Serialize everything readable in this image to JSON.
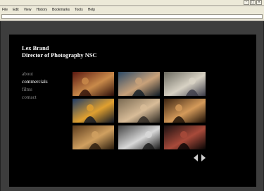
{
  "browser": {
    "menu": [
      "File",
      "Edit",
      "View",
      "History",
      "Bookmarks",
      "Tools",
      "Help"
    ],
    "window_buttons": [
      "minimize",
      "maximize",
      "close"
    ]
  },
  "site": {
    "brand_name": "Lex Brand",
    "brand_title": "Director of Photography NSC",
    "nav": [
      {
        "label": "about",
        "active": false
      },
      {
        "label": "commercials",
        "active": true
      },
      {
        "label": "films",
        "active": false
      },
      {
        "label": "contact",
        "active": false
      }
    ],
    "thumbnails": [
      {
        "name": "thumb-couple-in-car",
        "palette": [
          "#5a1810",
          "#c98a4a",
          "#2a0c08"
        ]
      },
      {
        "name": "thumb-woman-at-window",
        "palette": [
          "#2c4a66",
          "#c9a27a",
          "#0e1a24"
        ]
      },
      {
        "name": "thumb-woman-at-desk",
        "palette": [
          "#6b6a60",
          "#d8d2c4",
          "#3a3a46"
        ]
      },
      {
        "name": "thumb-kitchen-appliances",
        "palette": [
          "#1c3a66",
          "#e0a030",
          "#0c1424"
        ]
      },
      {
        "name": "thumb-man-shouting",
        "palette": [
          "#7a6a52",
          "#d8bc98",
          "#2a2620"
        ]
      },
      {
        "name": "thumb-man-with-guitar",
        "palette": [
          "#3a2210",
          "#d49a5a",
          "#180c04"
        ]
      },
      {
        "name": "thumb-group-at-counter",
        "palette": [
          "#5a3a1c",
          "#d0a060",
          "#281a0c"
        ]
      },
      {
        "name": "thumb-people-standing",
        "palette": [
          "#444444",
          "#d8d8d8",
          "#181818"
        ]
      },
      {
        "name": "thumb-dark-room",
        "palette": [
          "#1a1010",
          "#a84a3a",
          "#050404"
        ]
      }
    ],
    "pager": {
      "prev_icon": "chevron-left-icon",
      "next_icon": "chevron-right-icon"
    }
  }
}
